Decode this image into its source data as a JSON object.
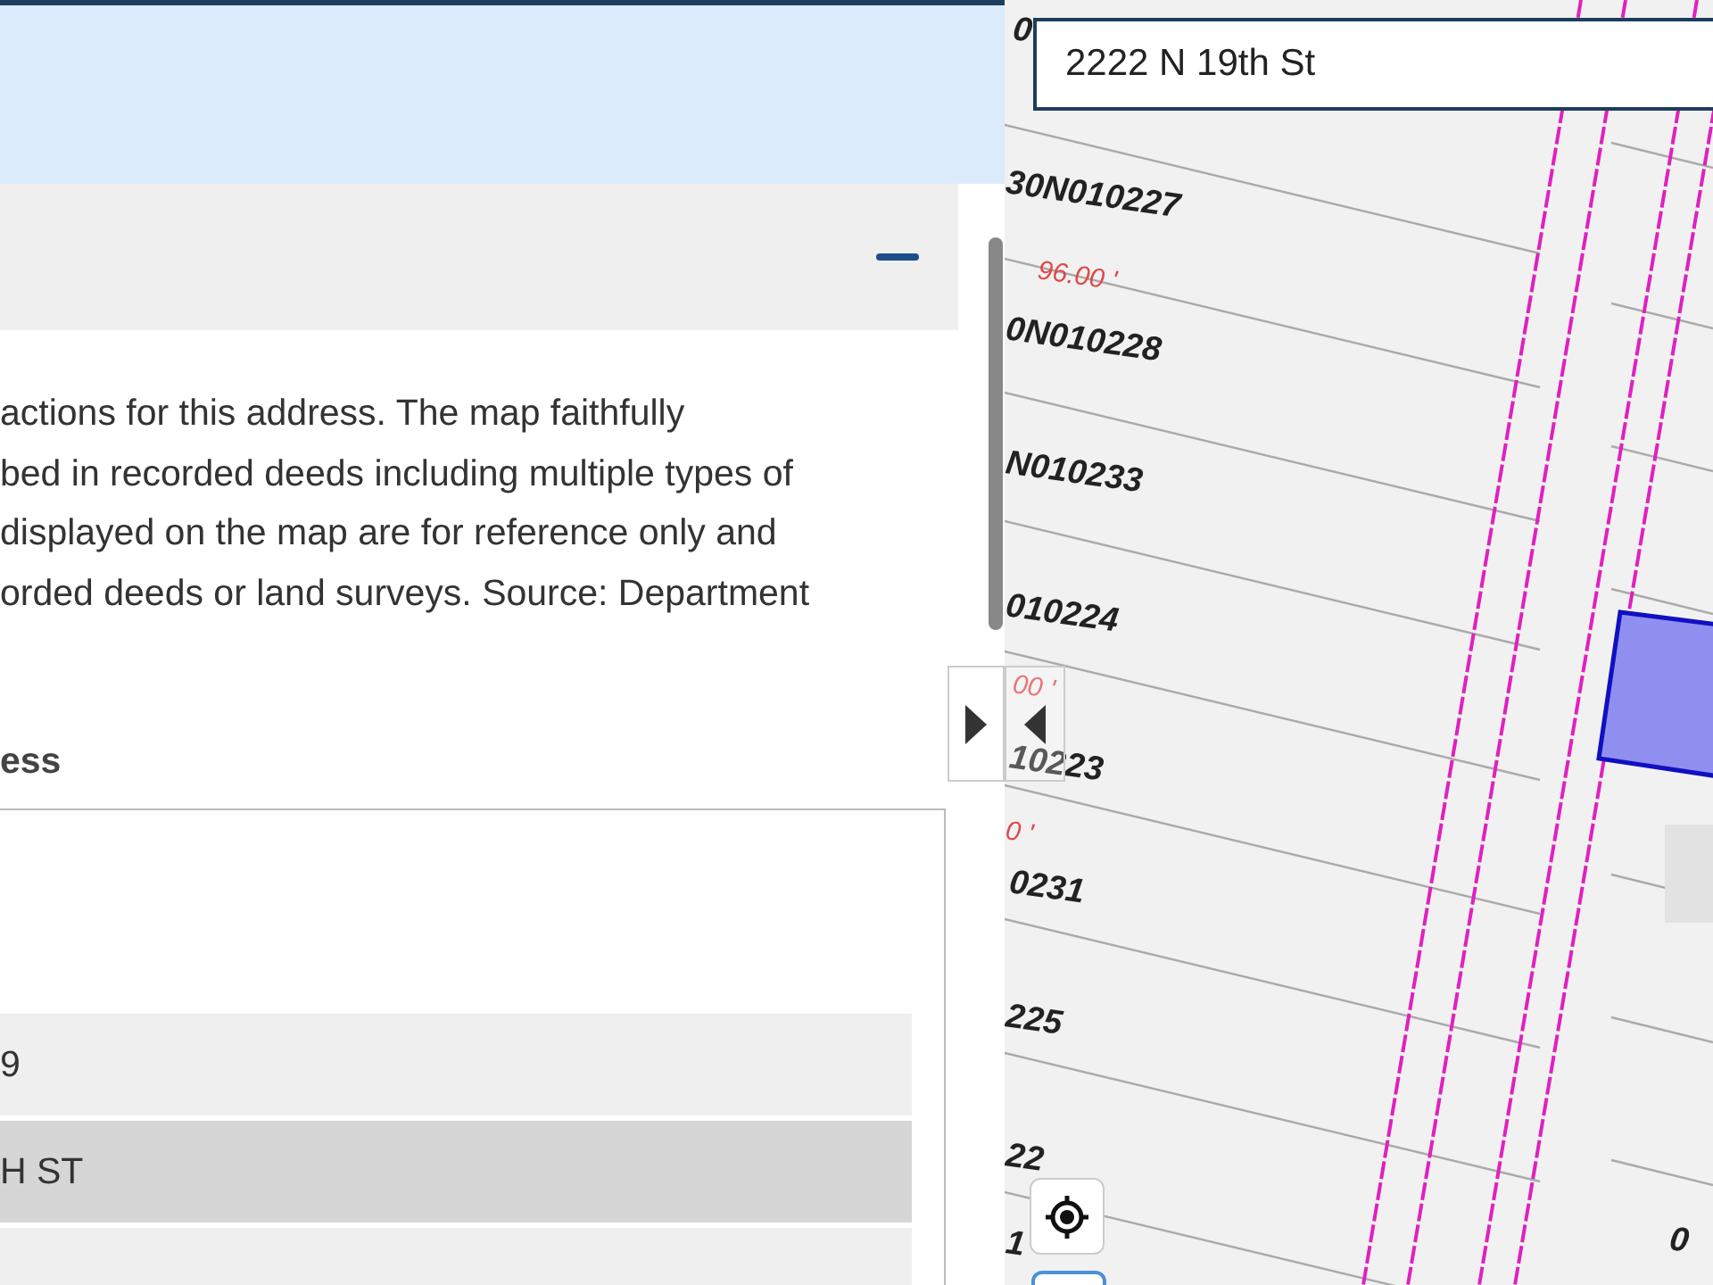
{
  "section": {
    "expanded": true
  },
  "description": {
    "lines": [
      "actions for this address. The map faithfully",
      "bed in recorded deeds including multiple types of",
      "displayed on the map are for reference only and",
      "orded deeds or land surveys. Source: Department"
    ]
  },
  "list": {
    "label": "ess",
    "rows": [
      {
        "text": "9",
        "selected": false
      },
      {
        "text": "H ST",
        "selected": true
      },
      {
        "selected": false
      }
    ]
  },
  "map": {
    "search": {
      "value": "2222 N 19th St"
    },
    "labels": [
      {
        "text": "0",
        "kind": "parcel"
      },
      {
        "text": "30N010227",
        "kind": "parcel"
      },
      {
        "text": "96.00 '",
        "kind": "dimension"
      },
      {
        "text": "0N010228",
        "kind": "parcel"
      },
      {
        "text": "N010233",
        "kind": "parcel"
      },
      {
        "text": "010224",
        "kind": "parcel"
      },
      {
        "text": "00 '",
        "kind": "dimension"
      },
      {
        "text": "10223",
        "kind": "parcel"
      },
      {
        "text": "0 '",
        "kind": "dimension"
      },
      {
        "text": "0231",
        "kind": "parcel"
      },
      {
        "text": "225",
        "kind": "parcel"
      },
      {
        "text": "22",
        "kind": "parcel"
      },
      {
        "text": "0",
        "kind": "parcel"
      },
      {
        "text": "1",
        "kind": "parcel"
      }
    ]
  }
}
